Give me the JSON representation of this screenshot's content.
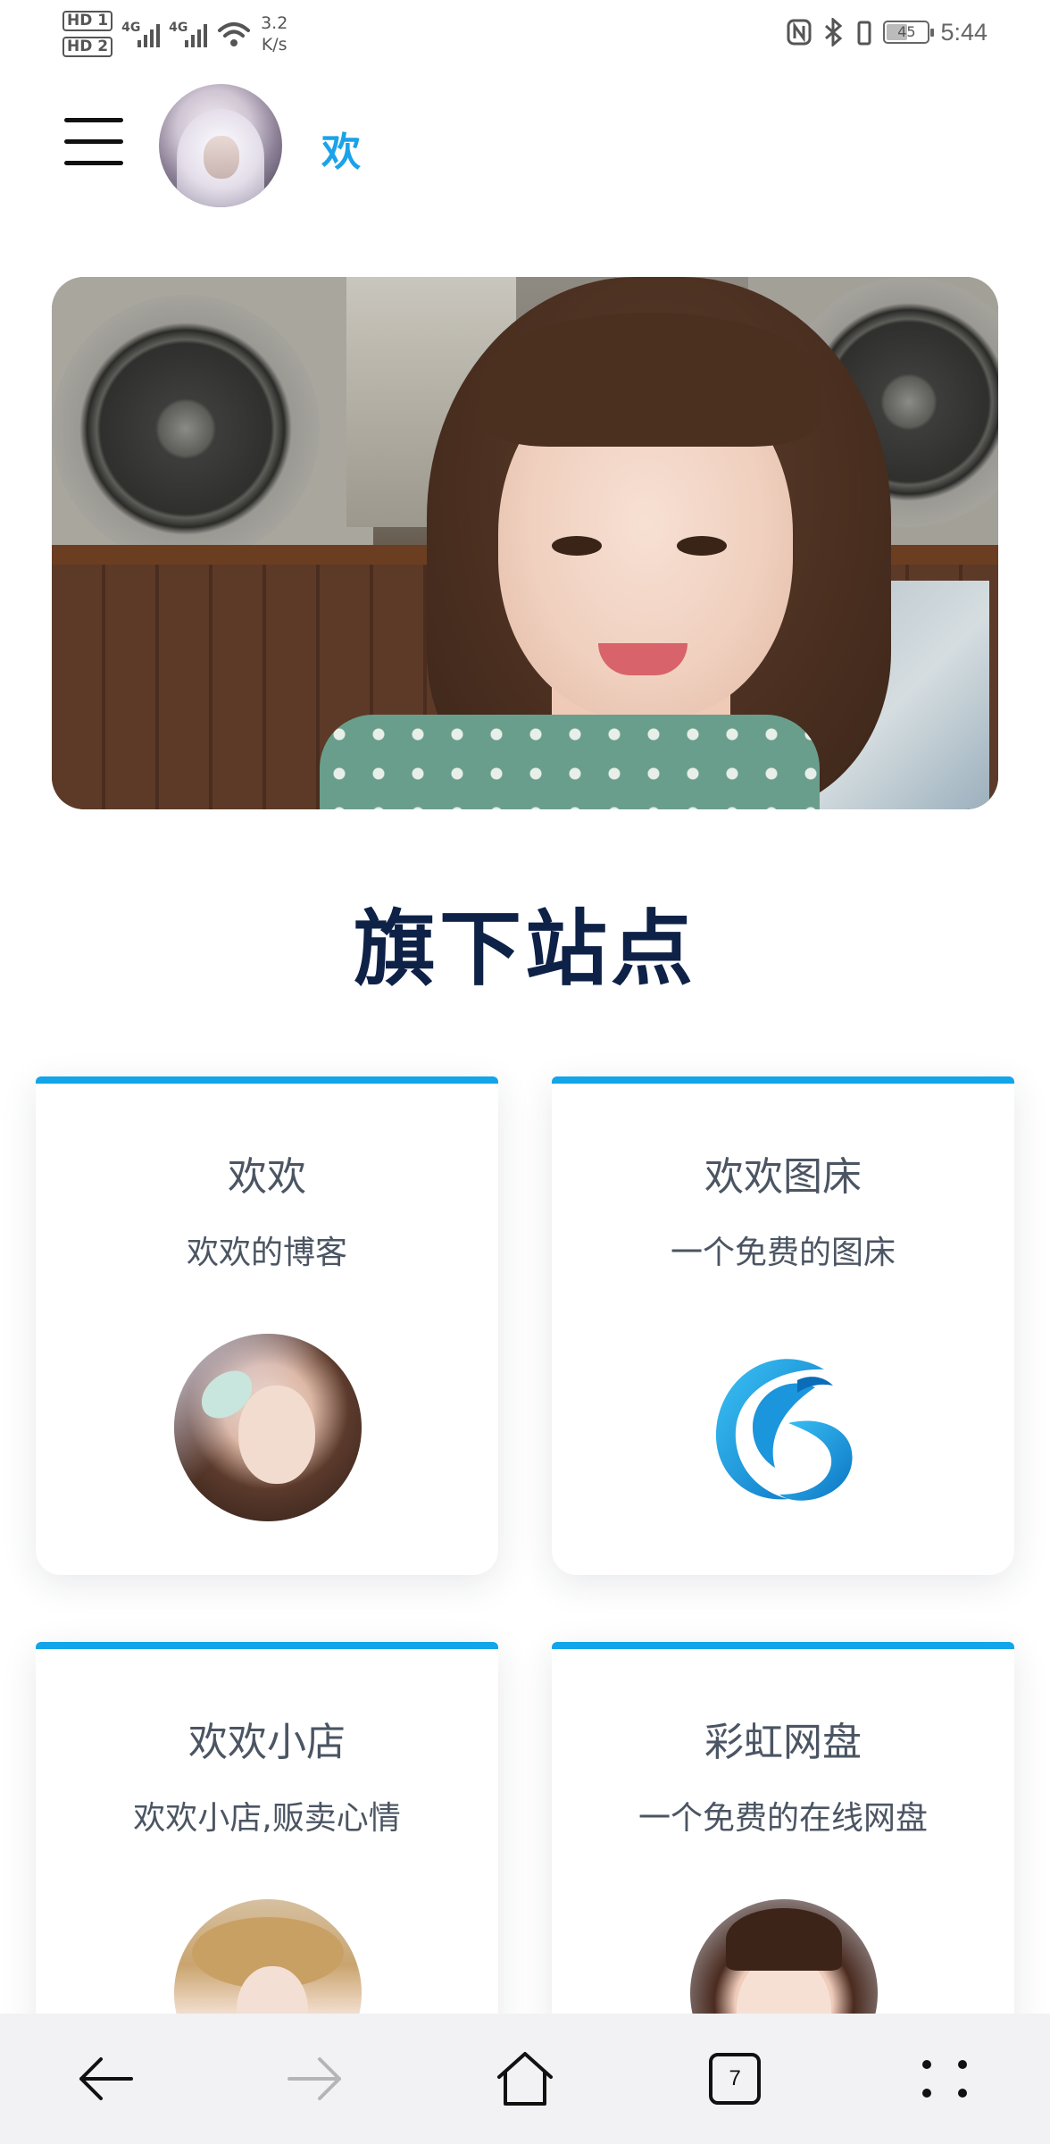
{
  "status_bar": {
    "hd1": "HD 1",
    "hd2": "HD 2",
    "net1": "4G",
    "net2": "4G",
    "speed_value": "3.2",
    "speed_unit": "K/s",
    "battery": "45",
    "time": "5:44",
    "icons": [
      "nfc-icon",
      "bluetooth-icon",
      "vibrate-icon",
      "battery-icon",
      "wifi-icon",
      "signal-icon"
    ]
  },
  "header": {
    "title": "欢",
    "menu_icon": "hamburger-menu-icon",
    "avatar": "profile-avatar"
  },
  "banner": {
    "image": "hero-banner-photo"
  },
  "section": {
    "title": "旗下站点"
  },
  "sites": [
    {
      "name": "欢欢",
      "desc": "欢欢的博客",
      "image": "blog-avatar"
    },
    {
      "name": "欢欢图床",
      "desc": "一个免费的图床",
      "image": "image-host-logo"
    },
    {
      "name": "欢欢小店",
      "desc": "欢欢小店,贩卖心情",
      "image": "shop-avatar"
    },
    {
      "name": "彩虹网盘",
      "desc": "一个免费的在线网盘",
      "image": "cloud-disk-avatar"
    }
  ],
  "bottom_nav": {
    "tab_count": "7",
    "icons": [
      "back-arrow-icon",
      "forward-arrow-icon",
      "home-icon",
      "tabs-icon",
      "more-icon"
    ]
  },
  "colors": {
    "accent": "#12a5e9",
    "heading": "#0e2147",
    "text": "#4b5563",
    "nav_bg": "#f2f2f4"
  }
}
